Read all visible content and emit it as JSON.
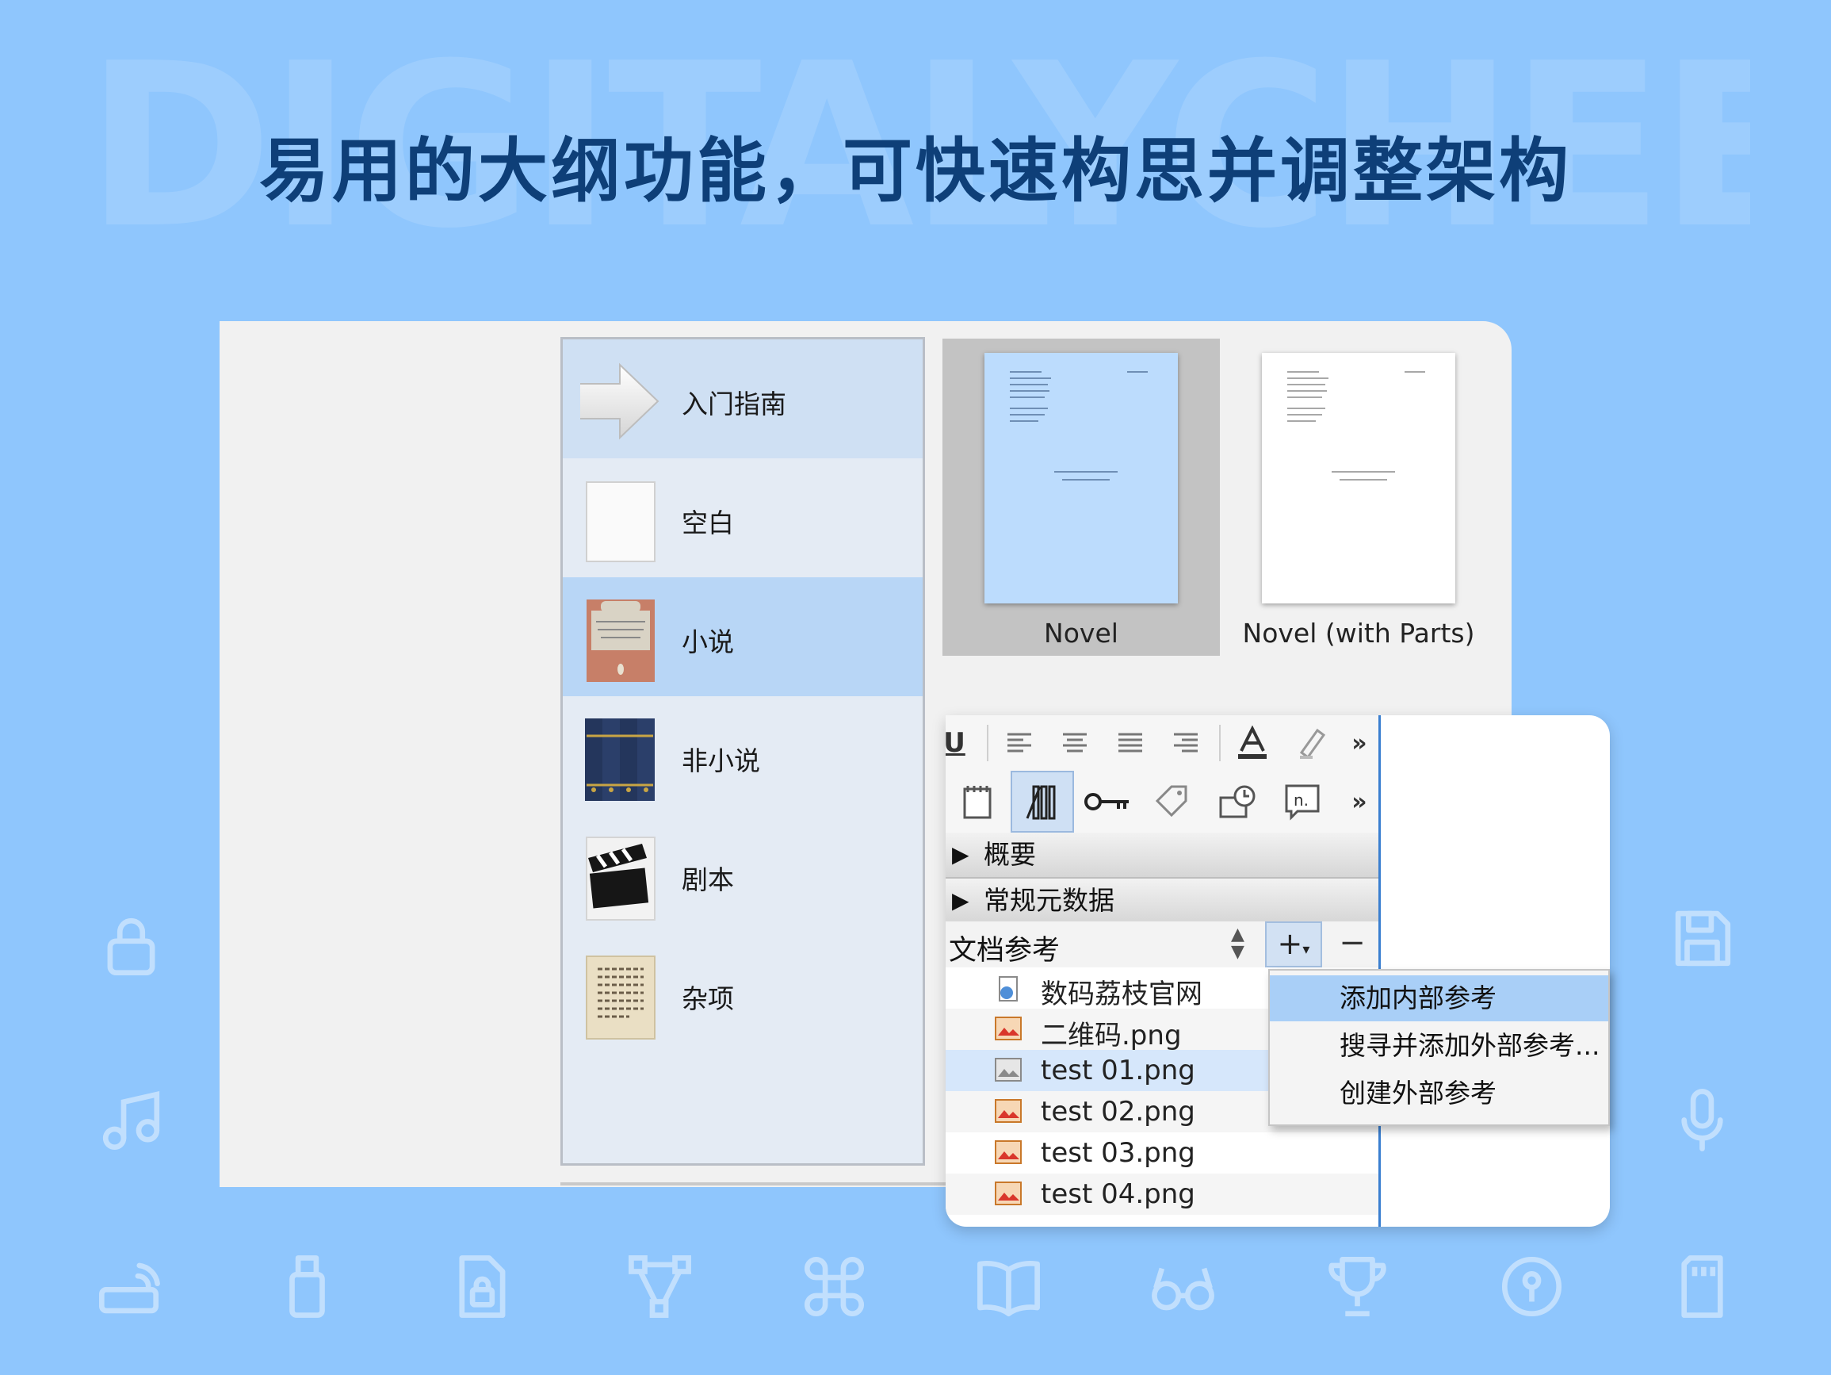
{
  "watermark": "DIGITALYCHEE",
  "headline": "易用的大纲功能，可快速构思并调整架构",
  "categories": [
    {
      "label": "入门指南",
      "icon": "arrow-icon"
    },
    {
      "label": "空白",
      "icon": "blank-page-icon"
    },
    {
      "label": "小说",
      "icon": "novel-book-icon"
    },
    {
      "label": "非小说",
      "icon": "books-icon"
    },
    {
      "label": "剧本",
      "icon": "clapperboard-icon"
    },
    {
      "label": "杂项",
      "icon": "misc-page-icon"
    }
  ],
  "templates": [
    {
      "label": "Novel",
      "selected": true
    },
    {
      "label": "Novel (with Parts)",
      "selected": false
    }
  ],
  "inspector": {
    "format_toolbar": [
      "U",
      "align-left",
      "align-center",
      "justify",
      "align-right",
      "text-color",
      "highlight",
      "»"
    ],
    "tab_toolbar": [
      "notes-icon",
      "bookmarks-icon",
      "key-icon",
      "tag-icon",
      "snapshot-icon",
      "comments-icon",
      "»"
    ],
    "sections": [
      {
        "label": "概要"
      },
      {
        "label": "常规元数据"
      }
    ],
    "refs_title": "文档参考",
    "plus_label": "+",
    "minus_label": "−",
    "references": [
      {
        "label": "数码荔枝官网",
        "icon": "web-link-icon"
      },
      {
        "label": "二维码.png",
        "icon": "image-file-icon"
      },
      {
        "label": "test 01.png",
        "icon": "image-file-icon"
      },
      {
        "label": "test 02.png",
        "icon": "image-file-icon"
      },
      {
        "label": "test 03.png",
        "icon": "image-file-icon"
      },
      {
        "label": "test 04.png",
        "icon": "image-file-icon"
      }
    ]
  },
  "context_menu": [
    {
      "label": "添加内部参考"
    },
    {
      "label": "搜寻并添加外部参考..."
    },
    {
      "label": "创建外部参考"
    }
  ],
  "colors": {
    "background": "#8fc6fd",
    "headline": "#0e3f78",
    "selection": "#b8d6f6",
    "menu_highlight": "#a9cff7"
  }
}
